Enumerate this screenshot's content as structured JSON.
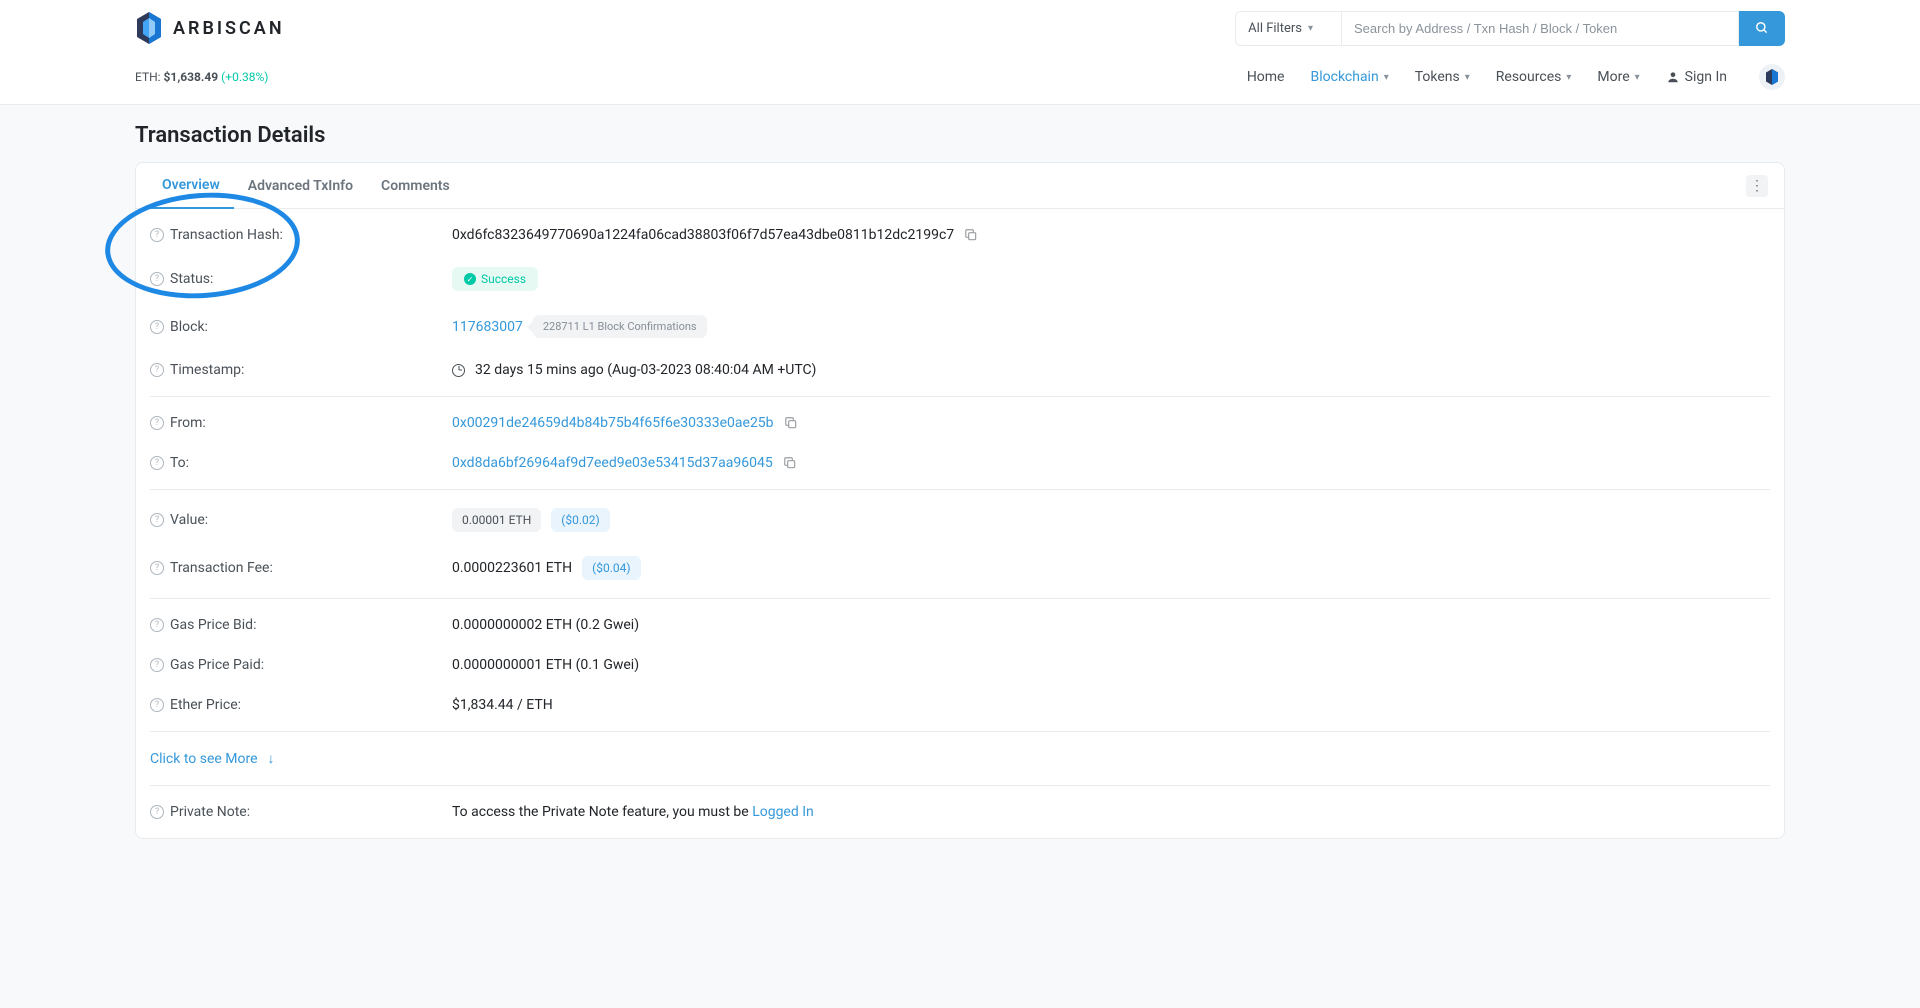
{
  "brand": {
    "name": "ARBISCAN"
  },
  "priceBar": {
    "label": "ETH: ",
    "value": "$1,638.49",
    "pct": "(+0.38%)"
  },
  "search": {
    "filterLabel": "All Filters",
    "placeholder": "Search by Address / Txn Hash / Block / Token"
  },
  "nav": {
    "home": "Home",
    "blockchain": "Blockchain",
    "tokens": "Tokens",
    "resources": "Resources",
    "more": "More",
    "signin": "Sign In"
  },
  "pageTitle": "Transaction Details",
  "tabs": {
    "overview": "Overview",
    "advanced": "Advanced TxInfo",
    "comments": "Comments"
  },
  "labels": {
    "txhash": "Transaction Hash:",
    "status": "Status:",
    "block": "Block:",
    "timestamp": "Timestamp:",
    "from": "From:",
    "to": "To:",
    "value": "Value:",
    "fee": "Transaction Fee:",
    "gasBid": "Gas Price Bid:",
    "gasPaid": "Gas Price Paid:",
    "ethPrice": "Ether Price:",
    "privateNote": "Private Note:"
  },
  "values": {
    "txhash": "0xd6fc8323649770690a1224fa06cad38803f06f7d57ea43dbe0811b12dc2199c7",
    "status": "Success",
    "block": "117683007",
    "confirmations": "228711 L1 Block Confirmations",
    "timestamp": "32 days 15 mins ago (Aug-03-2023 08:40:04 AM +UTC)",
    "from": "0x00291de24659d4b84b75b4f65f6e30333e0ae25b",
    "to": "0xd8da6bf26964af9d7eed9e03e53415d37aa96045",
    "valueEth": "0.00001 ETH",
    "valueUsd": "($0.02)",
    "feeEth": "0.0000223601 ETH",
    "feeUsd": "($0.04)",
    "gasBid": "0.0000000002 ETH (0.2 Gwei)",
    "gasPaid": "0.0000000001 ETH (0.1 Gwei)",
    "ethPrice": "$1,834.44 / ETH",
    "privateNotePrefix": "To access the Private Note feature, you must be ",
    "privateNoteLink": "Logged In"
  },
  "seeMore": "Click to see More"
}
